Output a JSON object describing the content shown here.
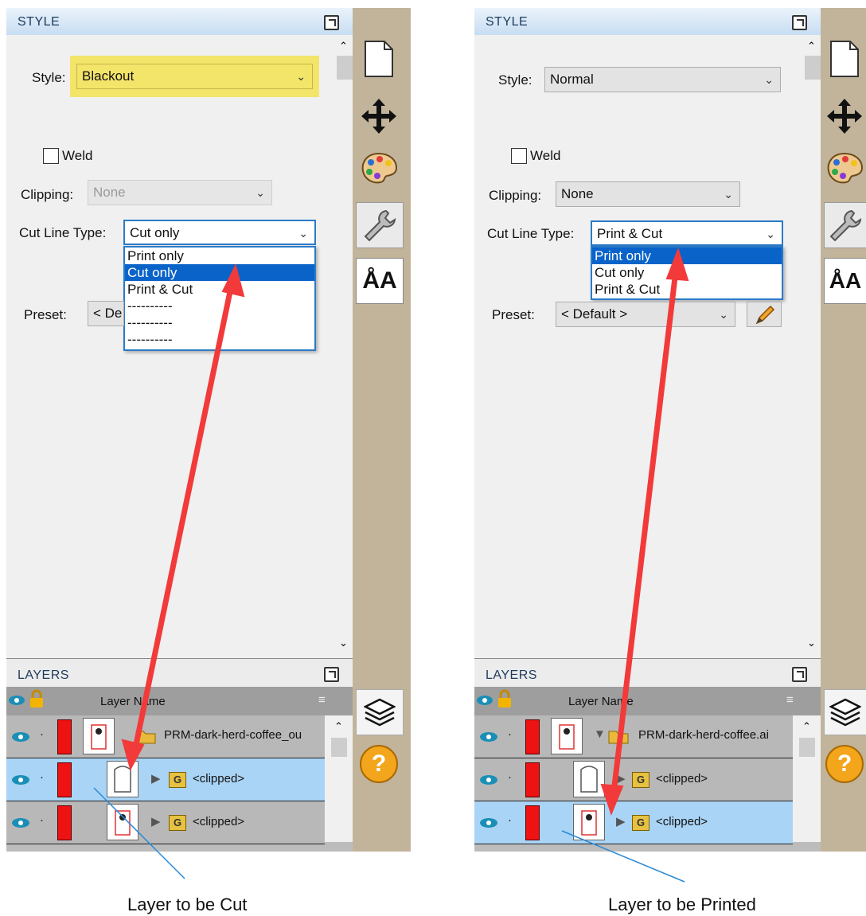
{
  "left": {
    "style_title": "STYLE",
    "style_label": "Style:",
    "style_value": "Blackout",
    "weld_label": "Weld",
    "clipping_label": "Clipping:",
    "clipping_value": "None",
    "cutline_label": "Cut Line Type:",
    "cutline_value": "Cut only",
    "dropdown_options": [
      "Print only",
      "Cut only",
      "Print & Cut",
      "----------",
      "----------",
      "----------"
    ],
    "preset_label": "Preset:",
    "preset_value": "< De",
    "layers_title": "LAYERS",
    "layer_name_header": "Layer Name",
    "layer_rows": [
      "PRM-dark-herd-coffee_ou",
      "<clipped>",
      "<clipped>"
    ],
    "caption": "Layer to be Cut"
  },
  "right": {
    "style_title": "STYLE",
    "style_label": "Style:",
    "style_value": "Normal",
    "weld_label": "Weld",
    "clipping_label": "Clipping:",
    "clipping_value": "None",
    "cutline_label": "Cut Line Type:",
    "cutline_value": "Print & Cut",
    "dropdown_options": [
      "Print only",
      "Cut only",
      "Print & Cut"
    ],
    "preset_label": "Preset:",
    "preset_value": "< Default >",
    "layers_title": "LAYERS",
    "layer_name_header": "Layer Name",
    "layer_rows": [
      "PRM-dark-herd-coffee.ai",
      "<clipped>",
      "<clipped>"
    ],
    "caption": "Layer to be Printed"
  },
  "icons": {
    "help": "?",
    "text_tool": "ÅA",
    "group_badge": "G"
  },
  "colors": {
    "accent_blue": "#0a63c9",
    "highlight_yellow": "#f3e46a",
    "arrow_red": "#f23a3a",
    "layer_selected": "#a9d4f5",
    "tool_strip": "#c2b49b"
  }
}
